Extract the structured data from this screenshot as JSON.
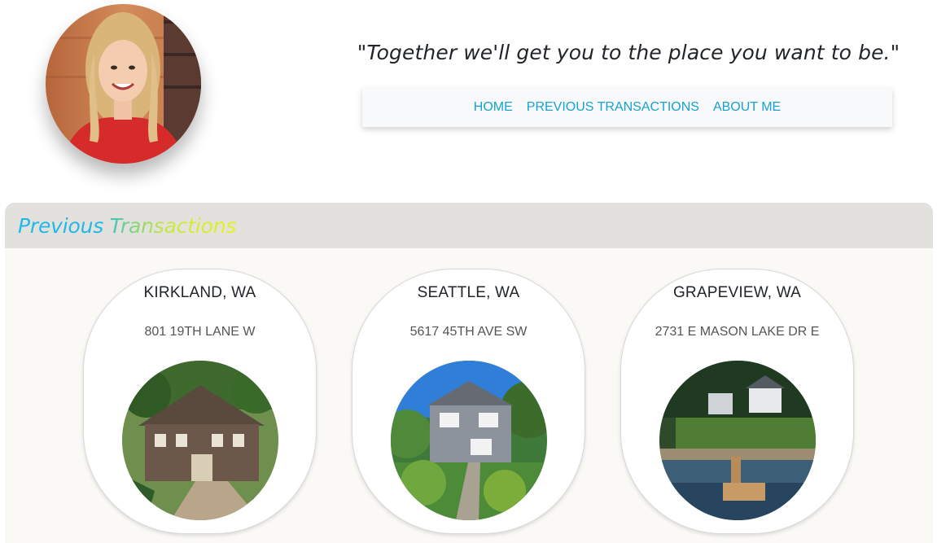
{
  "header": {
    "tagline": "\"Together we'll get you to the place you want to be.\"",
    "avatar_icon": "agent-portrait-photo"
  },
  "nav": {
    "items": [
      {
        "label": "HOME"
      },
      {
        "label": "PREVIOUS TRANSACTIONS"
      },
      {
        "label": "ABOUT ME"
      }
    ]
  },
  "section": {
    "title": "Previous Transactions"
  },
  "listings": [
    {
      "city": "KIRKLAND, WA",
      "address": "801 19TH LANE W"
    },
    {
      "city": "SEATTLE, WA",
      "address": "5617 45TH AVE SW"
    },
    {
      "city": "GRAPEVIEW, WA",
      "address": "2731 E MASON LAKE DR E"
    }
  ],
  "colors": {
    "nav_link": "#17a2cf",
    "section_header_bg": "#e2e1dd",
    "section_body_bg": "#faf9f6",
    "title_gradient": [
      "#1fb8e8",
      "#74d18a",
      "#e9f11a"
    ]
  }
}
